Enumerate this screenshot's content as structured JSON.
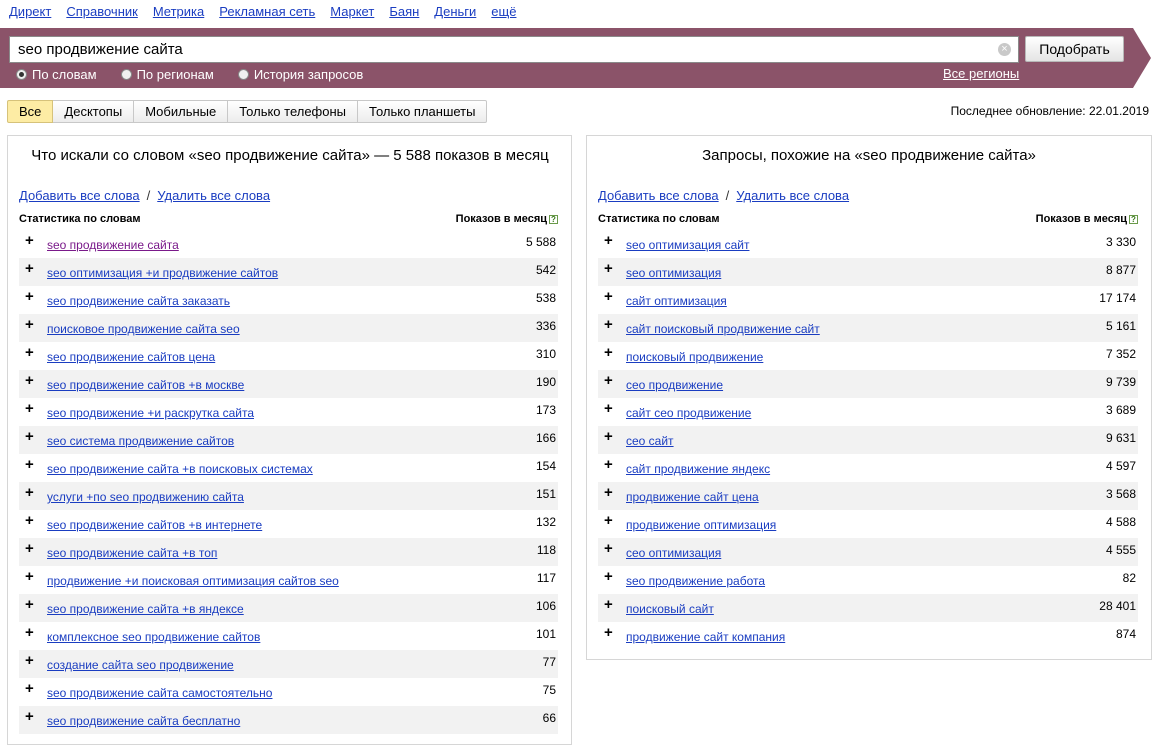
{
  "topnav": [
    "Директ",
    "Справочник",
    "Метрика",
    "Рекламная сеть",
    "Маркет",
    "Баян",
    "Деньги",
    "ещё"
  ],
  "search": {
    "value": "seo продвижение сайта",
    "clear_glyph": "×",
    "submit_label": "Подобрать",
    "modes": [
      {
        "label": "По словам",
        "selected": true
      },
      {
        "label": "По регионам",
        "selected": false
      },
      {
        "label": "История запросов",
        "selected": false
      }
    ],
    "regions_label": "Все регионы"
  },
  "device_tabs": [
    {
      "label": "Все",
      "active": true
    },
    {
      "label": "Десктопы",
      "active": false
    },
    {
      "label": "Мобильные",
      "active": false
    },
    {
      "label": "Только телефоны",
      "active": false
    },
    {
      "label": "Только планшеты",
      "active": false
    }
  ],
  "last_update": "Последнее обновление: 22.01.2019",
  "colors": {
    "band": "#8b5369",
    "accent_tab": "#fdeca4",
    "link": "#1a3dc1",
    "visited": "#7a1a8a"
  },
  "left_panel": {
    "title": "Что искали со словом «seo продвижение сайта» — 5 588 показов в месяц",
    "add_all": "Добавить все слова",
    "remove_all": "Удалить все слова",
    "separator": "/",
    "col_stat": "Статистика по словам",
    "col_count": "Показов в месяц",
    "help_glyph": "?",
    "rows": [
      {
        "q": "seo продвижение сайта",
        "c": "5 588",
        "visited": true
      },
      {
        "q": "seo оптимизация +и продвижение сайтов",
        "c": "542"
      },
      {
        "q": "seo продвижение сайта заказать",
        "c": "538"
      },
      {
        "q": "поисковое продвижение сайта seo",
        "c": "336"
      },
      {
        "q": "seo продвижение сайтов цена",
        "c": "310"
      },
      {
        "q": "seo продвижение сайтов +в москве",
        "c": "190"
      },
      {
        "q": "seo продвижение +и раскрутка сайта",
        "c": "173"
      },
      {
        "q": "seo система продвижение сайтов",
        "c": "166"
      },
      {
        "q": "seo продвижение сайта +в поисковых системах",
        "c": "154"
      },
      {
        "q": "услуги +по seo продвижению сайта",
        "c": "151"
      },
      {
        "q": "seo продвижение сайтов +в интернете",
        "c": "132"
      },
      {
        "q": "seo продвижение сайта +в топ",
        "c": "118"
      },
      {
        "q": "продвижение +и поисковая оптимизация сайтов seo",
        "c": "117"
      },
      {
        "q": "seo продвижение сайта +в яндексе",
        "c": "106"
      },
      {
        "q": "комплексное seo продвижение сайтов",
        "c": "101"
      },
      {
        "q": "создание сайта seo продвижение",
        "c": "77"
      },
      {
        "q": "seo продвижение сайта самостоятельно",
        "c": "75"
      },
      {
        "q": "seo продвижение сайта бесплатно",
        "c": "66"
      }
    ]
  },
  "right_panel": {
    "title": "Запросы, похожие на «seo продвижение сайта»",
    "add_all": "Добавить все слова",
    "remove_all": "Удалить все слова",
    "separator": "/",
    "col_stat": "Статистика по словам",
    "col_count": "Показов в месяц",
    "help_glyph": "?",
    "rows": [
      {
        "q": "seo оптимизация сайт",
        "c": "3 330"
      },
      {
        "q": "seo оптимизация",
        "c": "8 877"
      },
      {
        "q": "сайт оптимизация",
        "c": "17 174"
      },
      {
        "q": "сайт поисковый продвижение сайт",
        "c": "5 161"
      },
      {
        "q": "поисковый продвижение",
        "c": "7 352"
      },
      {
        "q": "сео продвижение",
        "c": "9 739"
      },
      {
        "q": "сайт сео продвижение",
        "c": "3 689"
      },
      {
        "q": "сео сайт",
        "c": "9 631"
      },
      {
        "q": "сайт продвижение яндекс",
        "c": "4 597"
      },
      {
        "q": "продвижение сайт цена",
        "c": "3 568"
      },
      {
        "q": "продвижение оптимизация",
        "c": "4 588"
      },
      {
        "q": "сео оптимизация",
        "c": "4 555"
      },
      {
        "q": "seo продвижение работа",
        "c": "82"
      },
      {
        "q": "поисковый сайт",
        "c": "28 401"
      },
      {
        "q": "продвижение сайт компания",
        "c": "874"
      }
    ]
  }
}
